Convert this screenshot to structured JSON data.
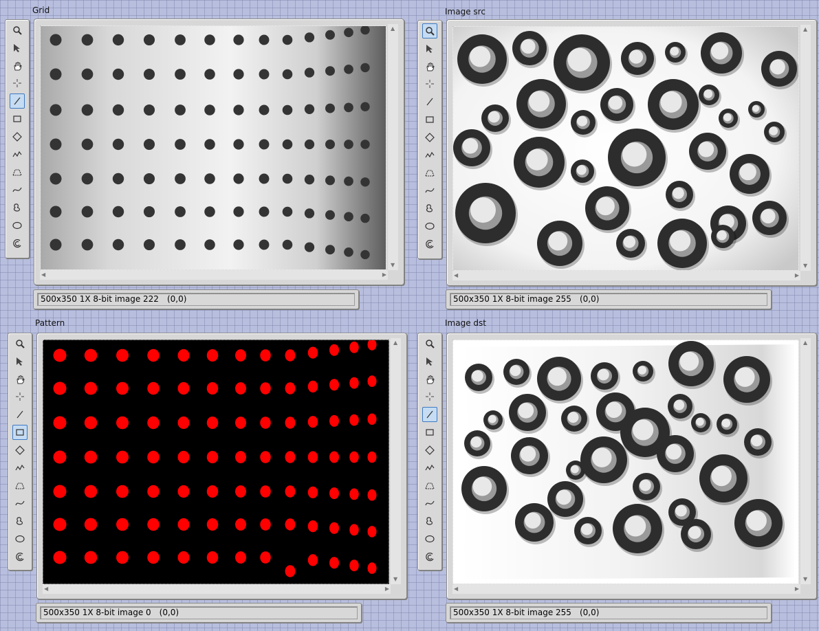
{
  "panels": [
    {
      "id": "grid",
      "title": "Grid",
      "status_info": "500x350 1X 8-bit image 222",
      "status_coord": "(0,0)",
      "active_tool": "line"
    },
    {
      "id": "src",
      "title": "Image src",
      "status_info": "500x350 1X 8-bit image 255",
      "status_coord": "(0,0)",
      "active_tool": "zoom"
    },
    {
      "id": "pattern",
      "title": "Pattern",
      "status_info": "500x350 1X 8-bit image 0",
      "status_coord": "(0,0)",
      "active_tool": "rectangle"
    },
    {
      "id": "dst",
      "title": "Image dst",
      "status_info": "500x350 1X 8-bit image 255",
      "status_coord": "(0,0)",
      "active_tool": "line"
    }
  ],
  "tools": [
    "zoom-icon",
    "pointer-icon",
    "pan-hand-icon",
    "crosshair-icon",
    "line-icon",
    "rectangle-icon",
    "rotated-rect-icon",
    "polyline-icon",
    "annulus-icon",
    "freehand-line-icon",
    "freehand-region-icon",
    "oval-icon",
    "broken-annulus-icon"
  ],
  "colors": {
    "background": "#b8bedd",
    "dot_red": "#ff0000",
    "pattern_bg": "#000000",
    "grid_dot": "#333333"
  }
}
